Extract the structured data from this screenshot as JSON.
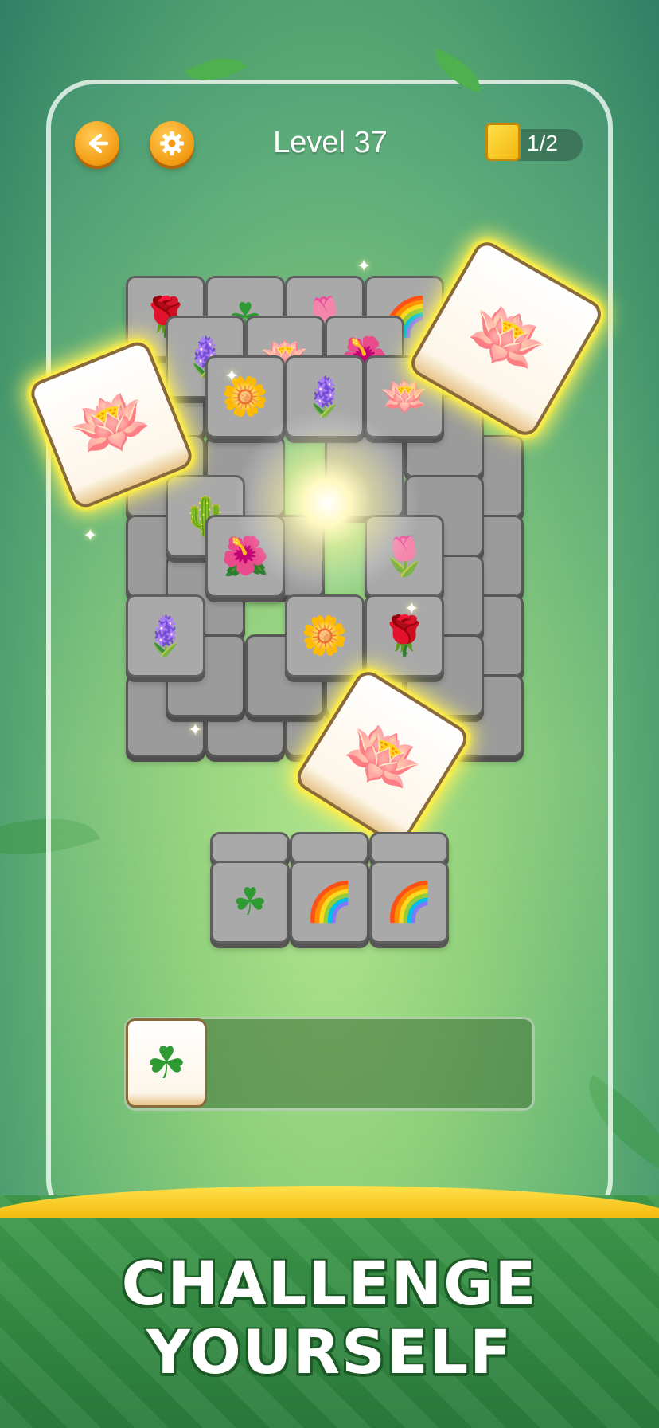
{
  "header": {
    "back_icon": "arrow-left-icon",
    "settings_icon": "gear-icon",
    "level_title": "Level 37",
    "progress_text": "1/2"
  },
  "board": {
    "top_layer": [
      {
        "icon": "rose",
        "glyph": "🌹"
      },
      {
        "icon": "clover",
        "glyph": "☘"
      },
      {
        "icon": "tulip",
        "glyph": "🌷"
      },
      {
        "icon": "rainbow",
        "glyph": "🌈"
      },
      {
        "icon": "bellflower",
        "glyph": "🪻"
      },
      {
        "icon": "lotus",
        "glyph": "🪷"
      },
      {
        "icon": "hibiscus",
        "glyph": "🌺"
      },
      {
        "icon": "sunflower",
        "glyph": "🌼"
      },
      {
        "icon": "bellflower",
        "glyph": "🪻"
      },
      {
        "icon": "lotus",
        "glyph": "🪷"
      },
      {
        "icon": "cactus",
        "glyph": "🌵"
      },
      {
        "icon": "hibiscus",
        "glyph": "🌺"
      },
      {
        "icon": "tulip",
        "glyph": "🌷"
      },
      {
        "icon": "bellflower",
        "glyph": "🪻"
      },
      {
        "icon": "sunflower",
        "glyph": "🌼"
      },
      {
        "icon": "rose",
        "glyph": "🌹"
      }
    ],
    "glowing_tiles": [
      {
        "icon": "lotus",
        "glyph": "🪷"
      },
      {
        "icon": "lotus",
        "glyph": "🪷"
      },
      {
        "icon": "lotus",
        "glyph": "🪷"
      }
    ],
    "stack_tiles": [
      {
        "icon": "clover",
        "glyph": "☘"
      },
      {
        "icon": "rainbow",
        "glyph": "🌈"
      },
      {
        "icon": "rainbow",
        "glyph": "🌈"
      }
    ]
  },
  "tray": {
    "slots": [
      {
        "icon": "clover",
        "glyph": "☘"
      }
    ]
  },
  "banner": {
    "line1": "CHALLENGE",
    "line2": "YOURSELF"
  },
  "colors": {
    "accent_orange": "#f39a12",
    "banner_green": "#2b7c3d",
    "banner_gold": "#f3bb10",
    "glow_yellow": "#fff25a"
  }
}
